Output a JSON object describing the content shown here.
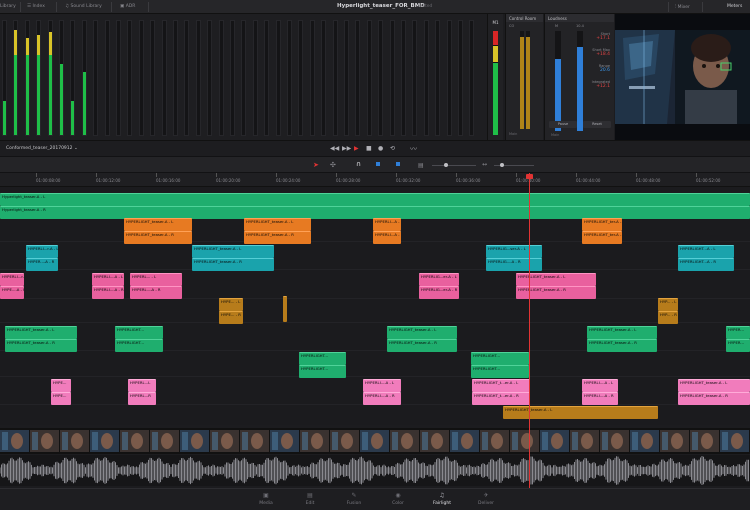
{
  "project_title": "Hyperlight_teaser_FOR_BMD",
  "project_status": "Edited",
  "topbar": {
    "items": [
      {
        "label": "Library",
        "icon": "library-icon"
      },
      {
        "label": "Index",
        "icon": "index-icon"
      },
      {
        "label": "Sound Library",
        "icon": "sound-library-icon"
      },
      {
        "label": "ADR",
        "icon": "adr-icon"
      }
    ],
    "mixer_label": "Mixer",
    "meters_label": "Meters"
  },
  "meters_panel": {
    "m1_label": "M1",
    "control_room": {
      "title": "Control Room",
      "label": "CO",
      "footer": "Main"
    },
    "loudness": {
      "title": "Loudness",
      "m_label": "M",
      "tp_value": "10.4",
      "short_label": "Short",
      "short_value": "+17.1",
      "short_max_label": "Short Max",
      "short_max_value": "+18.4",
      "range_label": "Range",
      "range_value": "20.6",
      "integrated_label": "Integrated",
      "integrated_value": "+12.1",
      "pause_label": "Pause",
      "reset_label": "Reset",
      "footer": "Main"
    },
    "colors": {
      "green": "#1fbf48",
      "yellow": "#d9c428",
      "red": "#d82626",
      "blue": "#2f7fd8",
      "mustard": "#b08418"
    }
  },
  "timeline_name": "Conformed_teaser_20170912",
  "ruler_timecodes": [
    "01:00:08:00",
    "01:00:12:00",
    "01:00:16:00",
    "01:00:20:00",
    "01:00:24:00",
    "01:00:28:00",
    "01:00:32:00",
    "01:00:36:00",
    "01:00:40:00",
    "01:00:44:00",
    "01:00:48:00",
    "01:00:52:00"
  ],
  "clips": {
    "a1l": "Hyperlight_teaser-A - L",
    "a1r": "Hyperlight_teaser-A - R",
    "o1": "HYPERLIGHT_teaser-A - L",
    "o2": "HYPERLIGHT_teaser-A - R",
    "o3": "HYPERLIGHT_teaser-A - L",
    "o4": "HYPERLIGHT_teaser-A - R",
    "o5": "HYPERLI...A - L",
    "o6": "HYPERLI...A - R",
    "o7": "HYPERLIGHT_ter-A - L",
    "o8": "HYPERLIGHT_ter-A - R",
    "t1": "HYPERLI...r-A - L",
    "t2": "HYPER...-A - R",
    "t3": "HYPERLIGHT_teaser-A - L",
    "t4": "HYPERLIGHT_teaser-A - R",
    "t5": "HYPERLIG...ser-A - L",
    "t6": "HYPERLIG...-A - R",
    "t7": "HYPERLIGHT...A - L",
    "t8": "HYPERLIGHT...A - R",
    "p1": "HYPERLI...r-A - L",
    "p2": "HYPE...-A - R",
    "p3": "HYPERLI...-A - L",
    "p4": "HYPERLI...-A - R",
    "p5": "HYPERL... - L",
    "p6": "HYPERL...-A - R",
    "p7": "HYPERLIG...er-A - L",
    "p8": "HYPERLIG...er-A - R",
    "p9": "HYPERLIGHT_teaser-A - L",
    "p10": "HYPERLIGHT_teaser-A - R",
    "m1": "HYPE... - L",
    "m2": "HYPE... - R",
    "m3": "HYP... - L",
    "m4": "HYP... - R",
    "g1": "HYPERLIGHT_teaser-A - L",
    "g2": "HYPERLIGHT_teaser-A - R",
    "g3": "HYPERLIGHT...",
    "g4": "HYPERLIGHT...",
    "g5": "HYPERLIGHT_teaser-A - L",
    "g6": "HYPERLIGHT_teaser-A - R",
    "g7": "HYPERLIGHT_teaser-A - L",
    "g8": "HYPERLIGHT_teaser-A - R",
    "g9": "HYPERLIGHT...",
    "g10": "HYPERLIGHT...",
    "g11": "HYPERLIGHT...",
    "g12": "HYPERLIGHT...",
    "g13": "HYPERLIGHT_teaser-A - L",
    "g14": "HYPERLIGHT_teaser-A - R",
    "g15": "HYPER...",
    "g16": "HYPER...",
    "l1": "HYPE...",
    "l2": "HYPE...",
    "l3": "HYPERL...L",
    "l4": "HYPERL...R",
    "l5": "HYPERLI...-A - L",
    "l6": "HYPERLI...-A - R",
    "l7": "HYPERLIGHT_t...er-A - L",
    "l8": "HYPERLIGHT_t...er-A - R",
    "l9": "HYPERLI...-A - L",
    "l10": "HYPERLI...-A - R",
    "l11": "HYPERLIGHT_teaser-A - L",
    "l12": "HYPERLIGHT_teaser-A - R",
    "mm1": "HYPERLIGHT_teaser-A - L"
  },
  "pages": [
    {
      "label": "Media",
      "icon": "media-icon",
      "glyph": "▣"
    },
    {
      "label": "Edit",
      "icon": "edit-icon",
      "glyph": "▤"
    },
    {
      "label": "Fusion",
      "icon": "fusion-icon",
      "glyph": "✎"
    },
    {
      "label": "Color",
      "icon": "color-icon",
      "glyph": "◉"
    },
    {
      "label": "Fairlight",
      "icon": "fairlight-icon",
      "glyph": "♫"
    },
    {
      "label": "Deliver",
      "icon": "deliver-icon",
      "glyph": "✈"
    }
  ],
  "active_page": "Fairlight"
}
